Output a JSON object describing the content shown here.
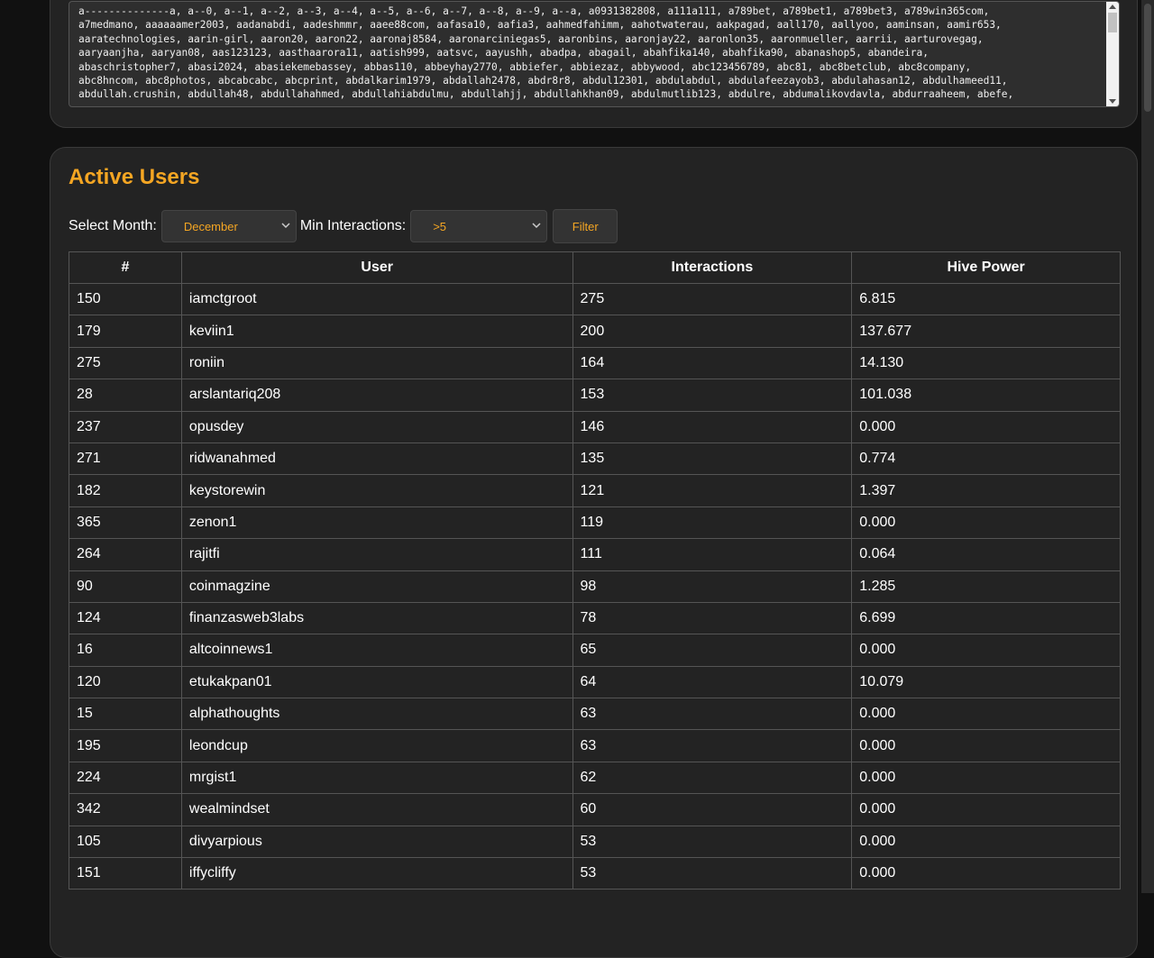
{
  "accounts_list": {
    "lines": [
      "a--------------a, a--0, a--1, a--2, a--3, a--4, a--5, a--6, a--7, a--8, a--9, a--a, a0931382808, a111a111, a789bet, a789bet1, a789bet3, a789win365com,",
      "a7medmano, aaaaaamer2003, aadanabdi, aadeshmmr, aaee88com, aafasa10, aafia3, aahmedfahimm, aahotwaterau, aakpagad, aall170, aallyoo, aaminsan, aamir653,",
      "aaratechnologies, aarin-girl, aaron20, aaron22, aaronaj8584, aaronarciniegas5, aaronbins, aaronjay22, aaronlon35, aaronmueller, aarrii, aarturovegag,",
      "aaryaanjha, aaryan08, aas123123, aasthaarora11, aatish999, aatsvc, aayushh, abadpa, abagail, abahfika140, abahfika90, abanashop5, abandeira,",
      "abaschristopher7, abasi2024, abasiekemebassey, abbas110, abbeyhay2770, abbiefer, abbiezaz, abbywood, abc123456789, abc81, abc8betclub, abc8company,",
      "abc8hncom, abc8photos, abcabcabc, abcprint, abdalkarim1979, abdallah2478, abdr8r8, abdul12301, abdulabdul, abdulafeezayob3, abdulahasan12, abdulhameed11,",
      "abdullah.crushin, abdullah48, abdullahahmed, abdullahiabdulmu, abdullahjj, abdullahkhan09, abdulmutlib123, abdulre, abdumalikovdavla, abdurraaheem, abefe,"
    ]
  },
  "active_users": {
    "title": "Active Users",
    "month_label": "Select Month:",
    "month_value": "December",
    "interactions_label": "Min Interactions:",
    "interactions_value": ">5",
    "filter_label": "Filter",
    "headers": [
      "#",
      "User",
      "Interactions",
      "Hive Power"
    ],
    "rows": [
      [
        "150",
        "iamctgroot",
        "275",
        "6.815"
      ],
      [
        "179",
        "keviin1",
        "200",
        "137.677"
      ],
      [
        "275",
        "roniin",
        "164",
        "14.130"
      ],
      [
        "28",
        "arslantariq208",
        "153",
        "101.038"
      ],
      [
        "237",
        "opusdey",
        "146",
        "0.000"
      ],
      [
        "271",
        "ridwanahmed",
        "135",
        "0.774"
      ],
      [
        "182",
        "keystorewin",
        "121",
        "1.397"
      ],
      [
        "365",
        "zenon1",
        "119",
        "0.000"
      ],
      [
        "264",
        "rajitfi",
        "111",
        "0.064"
      ],
      [
        "90",
        "coinmagzine",
        "98",
        "1.285"
      ],
      [
        "124",
        "finanzasweb3labs",
        "78",
        "6.699"
      ],
      [
        "16",
        "altcoinnews1",
        "65",
        "0.000"
      ],
      [
        "120",
        "etukakpan01",
        "64",
        "10.079"
      ],
      [
        "15",
        "alphathoughts",
        "63",
        "0.000"
      ],
      [
        "195",
        "leondcup",
        "63",
        "0.000"
      ],
      [
        "224",
        "mrgist1",
        "62",
        "0.000"
      ],
      [
        "342",
        "wealmindset",
        "60",
        "0.000"
      ],
      [
        "105",
        "divyarpious",
        "53",
        "0.000"
      ],
      [
        "151",
        "iffycliffy",
        "53",
        "0.000"
      ]
    ]
  },
  "colors": {
    "accent": "#f5a623",
    "background": "#111111",
    "card": "#232323",
    "border": "#555555"
  }
}
